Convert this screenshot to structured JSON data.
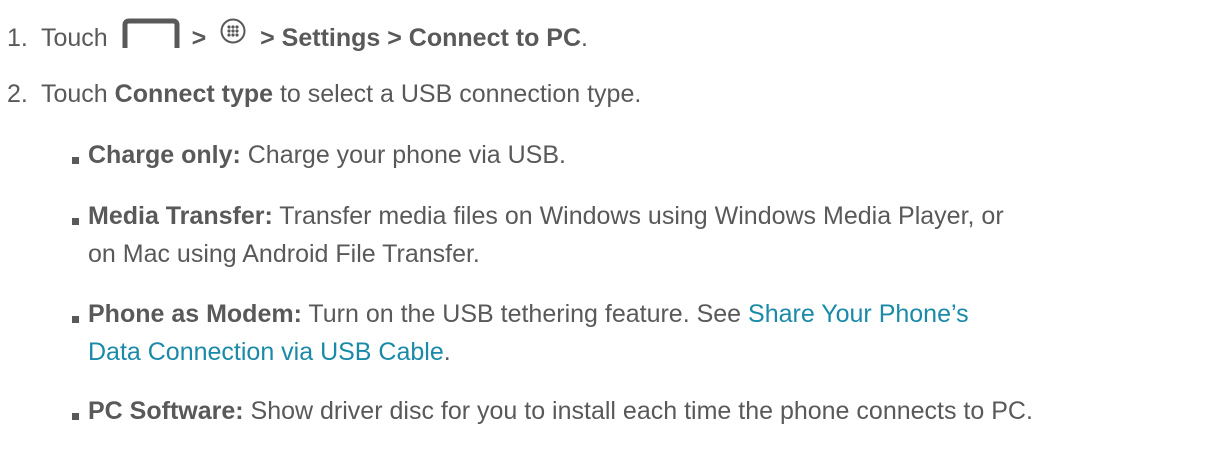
{
  "steps": [
    {
      "number": "1.",
      "text_touch": "Touch",
      "sep1": ">",
      "sep2": "> Settings > Connect to PC",
      "period": ".",
      "icons": [
        "home-icon",
        "apps-icon"
      ]
    },
    {
      "number": "2.",
      "text_before": "Touch ",
      "bold": "Connect type",
      "text_after": " to select a USB connection type."
    }
  ],
  "bullets": [
    {
      "term": "Charge only:",
      "desc_line1": " Charge your phone via USB.",
      "desc_line2": ""
    },
    {
      "term": "Media Transfer:",
      "desc_line1": " Transfer media files on Windows using Windows Media Player, or",
      "desc_line2": "on Mac using Android File Transfer."
    },
    {
      "term": "Phone as Modem:",
      "desc_line1": " Turn on the USB tethering feature. See ",
      "link_line1": "Share Your Phone’s",
      "link_line2": "Data Connection via USB Cable",
      "desc_end": "."
    },
    {
      "term": "PC Software:",
      "desc_line1": " Show driver disc for you to install each time the phone connects to PC."
    }
  ],
  "colors": {
    "text": "#595959",
    "link": "#1a8aa8"
  }
}
